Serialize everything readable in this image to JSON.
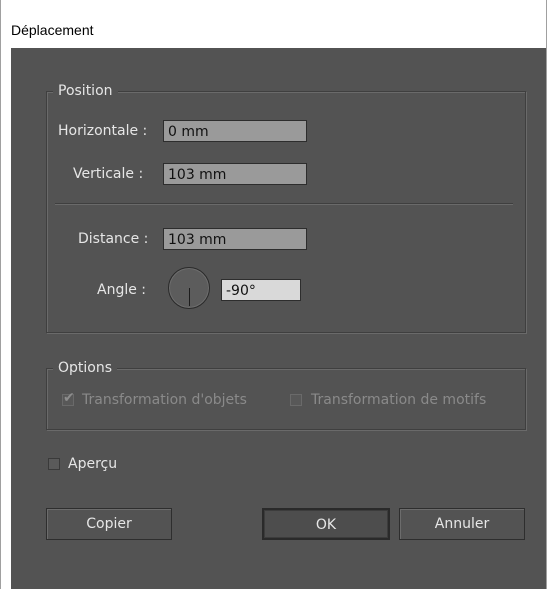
{
  "window": {
    "title": "Déplacement"
  },
  "position": {
    "legend": "Position",
    "horizontal_label": "Horizontale :",
    "horizontal_value": "0 mm",
    "vertical_label": "Verticale :",
    "vertical_value": "103 mm",
    "distance_label": "Distance :",
    "distance_value": "103 mm",
    "angle_label": "Angle :",
    "angle_value": "-90°"
  },
  "options": {
    "legend": "Options",
    "transform_objects_label": "Transformation d'objets",
    "transform_objects_checked": true,
    "transform_patterns_label": "Transformation de motifs",
    "transform_patterns_checked": false
  },
  "preview": {
    "label": "Aperçu",
    "checked": false
  },
  "buttons": {
    "copy": "Copier",
    "ok": "OK",
    "cancel": "Annuler"
  }
}
